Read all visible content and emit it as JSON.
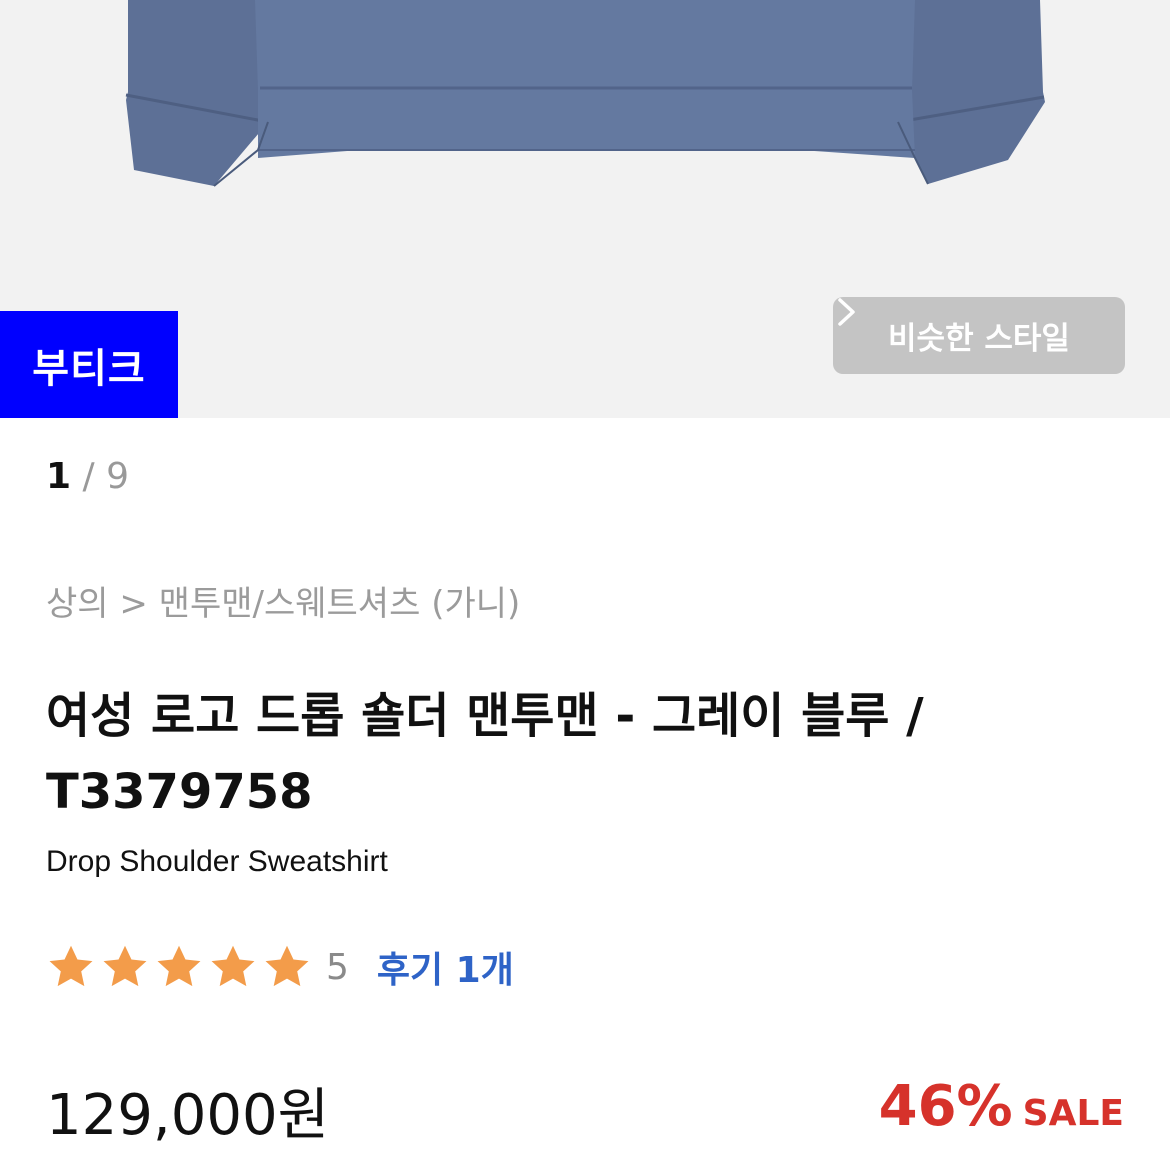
{
  "hero": {
    "badge_label": "부티크",
    "similar_style_label": "비슷한 스타일",
    "icons": {
      "similar": "chevron-right-icon"
    }
  },
  "pager": {
    "current": "1",
    "separator": " / ",
    "total": "9"
  },
  "breadcrumb": {
    "category": "상의",
    "separator": " > ",
    "subcategory": "맨투맨/스웨트셔츠",
    "brand": "(가니)"
  },
  "product": {
    "title": "여성 로고 드롭 숄더 맨투맨 - 그레이 블루 / T3379758",
    "subtitle": "Drop Shoulder Sweatshirt"
  },
  "rating": {
    "stars": 5,
    "max_stars": 5,
    "score": "5",
    "review_label": "후기 1개",
    "icons": {
      "star": "star-icon"
    }
  },
  "price": {
    "amount": "129,000원",
    "discount_percent": "46%",
    "sale_label": "SALE"
  },
  "colors": {
    "badge_bg": "#0000ff",
    "review_link": "#2e63c7",
    "discount": "#d6322b",
    "star": "#f39c4a",
    "garment": "#5c6f93"
  }
}
